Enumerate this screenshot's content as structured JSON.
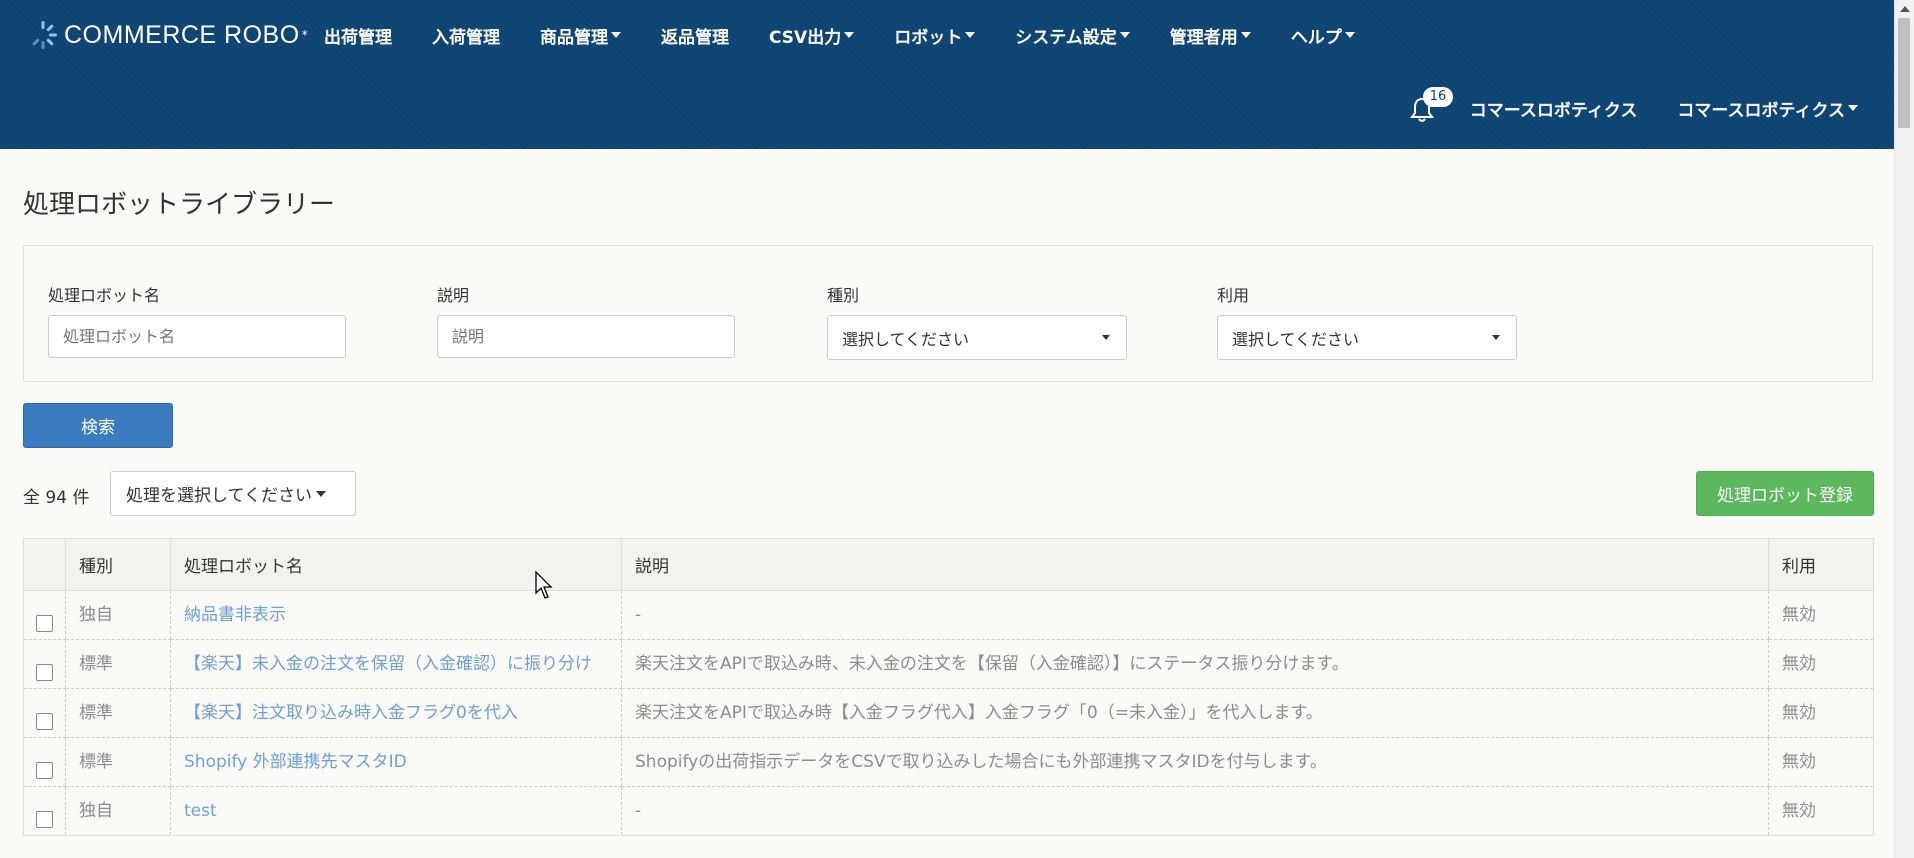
{
  "brand": {
    "logo_text": "COMMERCE ROBO",
    "logo_star": "*"
  },
  "nav": {
    "menu": [
      {
        "label": "出荷管理",
        "dropdown": false
      },
      {
        "label": "入荷管理",
        "dropdown": false
      },
      {
        "label": "商品管理",
        "dropdown": true
      },
      {
        "label": "返品管理",
        "dropdown": false
      },
      {
        "label": "CSV出力",
        "dropdown": true
      },
      {
        "label": "ロボット",
        "dropdown": true
      },
      {
        "label": "システム設定",
        "dropdown": true
      },
      {
        "label": "管理者用",
        "dropdown": true
      },
      {
        "label": "ヘルプ",
        "dropdown": true
      }
    ],
    "notification_count": "16",
    "company": "コマースロボティクス",
    "user": "コマースロボティクス"
  },
  "page": {
    "title": "処理ロボットライブラリー"
  },
  "search": {
    "name_label": "処理ロボット名",
    "name_placeholder": "処理ロボット名",
    "desc_label": "説明",
    "desc_placeholder": "説明",
    "type_label": "種別",
    "type_value": "選択してください",
    "use_label": "利用",
    "use_value": "選択してください",
    "button": "検索"
  },
  "list": {
    "count": "全 94 件",
    "action_select": "処理を選択してください",
    "register_button": "処理ロボット登録",
    "headers": [
      "種別",
      "処理ロボット名",
      "説明",
      "利用"
    ],
    "rows": [
      {
        "type": "独自",
        "name": "納品書非表示",
        "desc": "-",
        "use": "無効"
      },
      {
        "type": "標準",
        "name": "【楽天】未入金の注文を保留（入金確認）に振り分け",
        "desc": "楽天注文をAPIで取込み時、未入金の注文を【保留（入金確認）】にステータス振り分けます。",
        "use": "無効"
      },
      {
        "type": "標準",
        "name": "【楽天】注文取り込み時入金フラグ0を代入",
        "desc": "楽天注文をAPIで取込み時【入金フラグ代入】入金フラグ「0（=未入金）」を代入します。",
        "use": "無効"
      },
      {
        "type": "標準",
        "name": "Shopify 外部連携先マスタID",
        "desc": "Shopifyの出荷指示データをCSVで取り込みした場合にも外部連携マスタIDを付与します。",
        "use": "無効"
      },
      {
        "type": "独自",
        "name": "test",
        "desc": "-",
        "use": "無効"
      }
    ]
  }
}
